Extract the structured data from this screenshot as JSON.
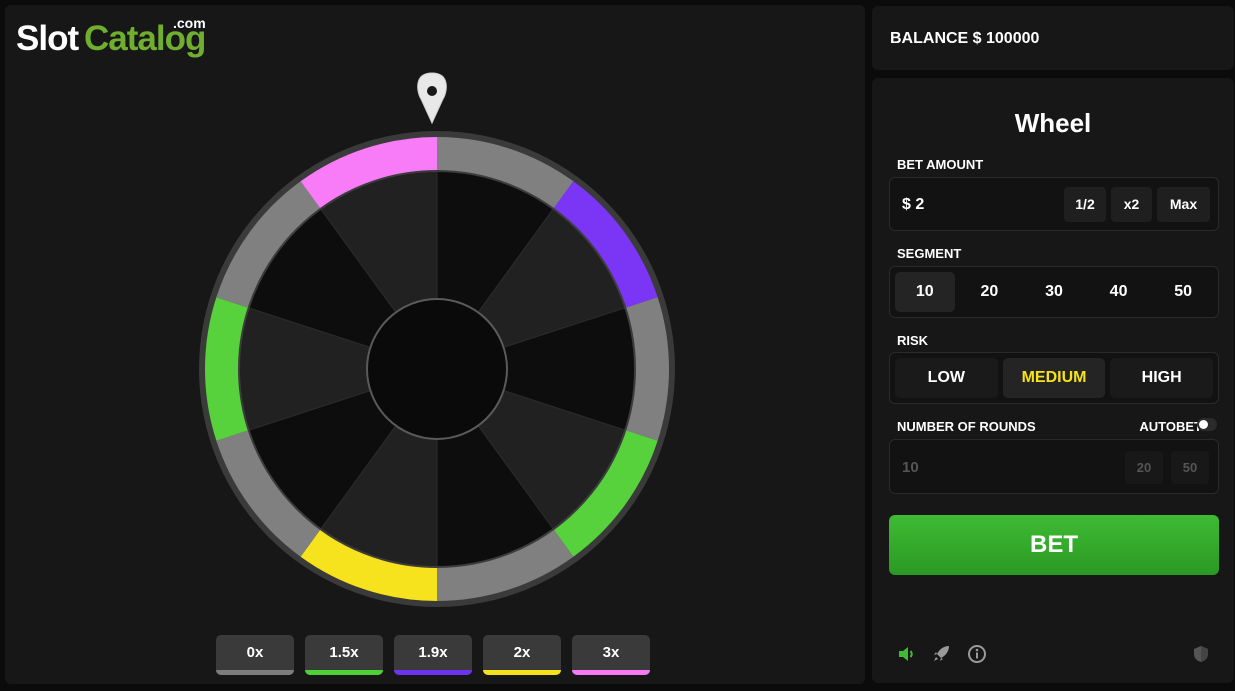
{
  "logo": {
    "part1": "Slot",
    "part2": "Catalog",
    "suffix": ".com"
  },
  "balance": {
    "text": "BALANCE $ 100000"
  },
  "controls": {
    "title": "Wheel",
    "bet_amount": {
      "label": "BET AMOUNT",
      "value": "$ 2",
      "half_label": "1/2",
      "double_label": "x2",
      "max_label": "Max"
    },
    "segment": {
      "label": "SEGMENT",
      "options": [
        "10",
        "20",
        "30",
        "40",
        "50"
      ],
      "selected": "10"
    },
    "risk": {
      "label": "RISK",
      "options": [
        "LOW",
        "MEDIUM",
        "HIGH"
      ],
      "selected": "MEDIUM"
    },
    "rounds": {
      "label": "NUMBER OF ROUNDS",
      "autobet_label": "AUTOBET",
      "autobet_on": false,
      "value": "10",
      "preset_20": "20",
      "preset_50": "50"
    },
    "bet_button": "BET"
  },
  "wheel": {
    "segment_count": 10,
    "segments_clockwise_from_top": [
      {
        "multiplier": "0x",
        "color": "#808080"
      },
      {
        "multiplier": "1.9x",
        "color": "#7a35f5"
      },
      {
        "multiplier": "0x",
        "color": "#808080"
      },
      {
        "multiplier": "1.5x",
        "color": "#57d23c"
      },
      {
        "multiplier": "0x",
        "color": "#808080"
      },
      {
        "multiplier": "2x",
        "color": "#f7e21e"
      },
      {
        "multiplier": "0x",
        "color": "#808080"
      },
      {
        "multiplier": "1.5x",
        "color": "#57d23c"
      },
      {
        "multiplier": "0x",
        "color": "#808080"
      },
      {
        "multiplier": "3x",
        "color": "#f87cf7"
      }
    ],
    "pointer_icon": "map-pin-icon"
  },
  "legend": [
    {
      "label": "0x",
      "color": "#7d7d7d"
    },
    {
      "label": "1.5x",
      "color": "#4fd035"
    },
    {
      "label": "1.9x",
      "color": "#6c34ee"
    },
    {
      "label": "2x",
      "color": "#f2e11b"
    },
    {
      "label": "3x",
      "color": "#f879f4"
    }
  ],
  "footer_icons": [
    "speaker-icon",
    "rocket-icon",
    "info-icon",
    "shield-icon"
  ],
  "colors": {
    "accent_green": "#3fbb33",
    "risk_active": "#f5e21a"
  }
}
